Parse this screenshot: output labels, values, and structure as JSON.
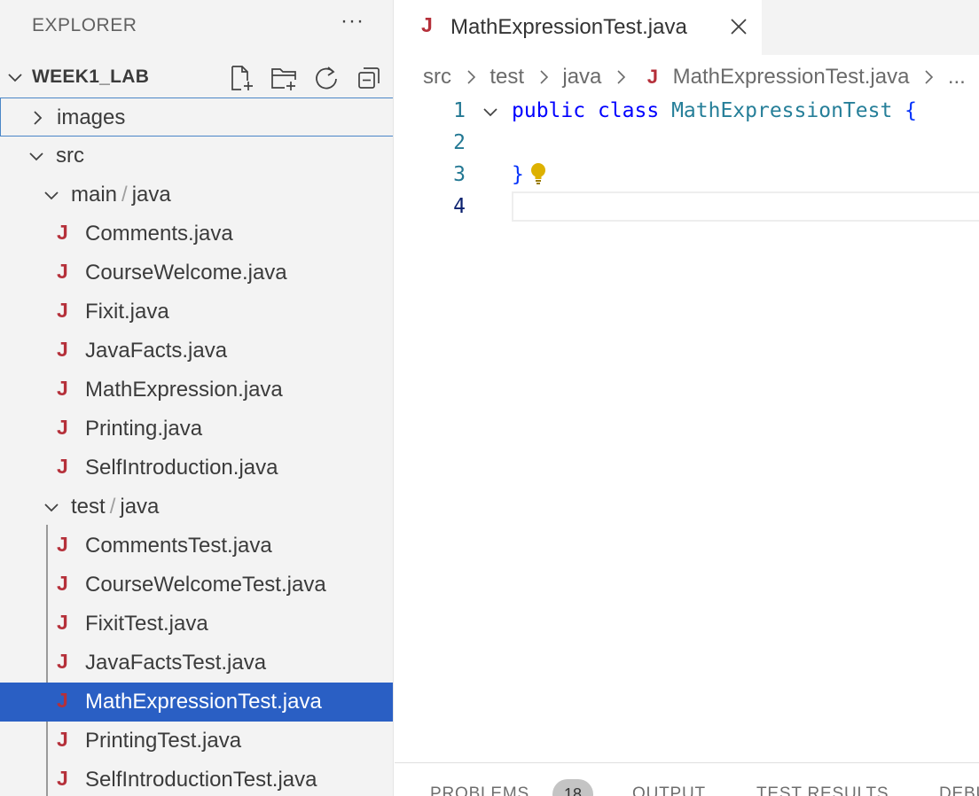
{
  "sidebar": {
    "title": "EXPLORER",
    "more_label": "···",
    "workspace": {
      "name": "WEEK1_LAB",
      "actions": [
        "new-file-icon",
        "new-folder-icon",
        "refresh-icon",
        "collapse-all-icon"
      ]
    },
    "tree": {
      "images": "images",
      "src": "src",
      "main_folder": "main",
      "main_sub": "java",
      "main_files": [
        "Comments.java",
        "CourseWelcome.java",
        "Fixit.java",
        "JavaFacts.java",
        "MathExpression.java",
        "Printing.java",
        "SelfIntroduction.java"
      ],
      "test_folder": "test",
      "test_sub": "java",
      "test_files": [
        "CommentsTest.java",
        "CourseWelcomeTest.java",
        "FixitTest.java",
        "JavaFactsTest.java",
        "MathExpressionTest.java",
        "PrintingTest.java",
        "SelfIntroductionTest.java"
      ],
      "path_sep": "/",
      "java_icon_glyph": "J"
    }
  },
  "editor": {
    "tab": {
      "label": "MathExpressionTest.java",
      "icon": "java-icon"
    },
    "breadcrumb": {
      "items": [
        "src",
        "test",
        "java"
      ],
      "file": "MathExpressionTest.java",
      "ellipsis": "..."
    },
    "lines": [
      {
        "num": "1",
        "kw1": "public",
        "kw2": "class",
        "cls": "MathExpressionTest",
        "brace": "{"
      },
      {
        "num": "2"
      },
      {
        "num": "3",
        "brace": "}"
      },
      {
        "num": "4"
      }
    ]
  },
  "panel": {
    "tabs": [
      "PROBLEMS",
      "OUTPUT",
      "TEST RESULTS",
      "DEBUG"
    ],
    "problems_count": "18"
  },
  "colors": {
    "accent_selected": "#2a5fc4",
    "java_icon": "#b5303a",
    "keyword": "#0000ff",
    "class_name": "#267f99"
  }
}
